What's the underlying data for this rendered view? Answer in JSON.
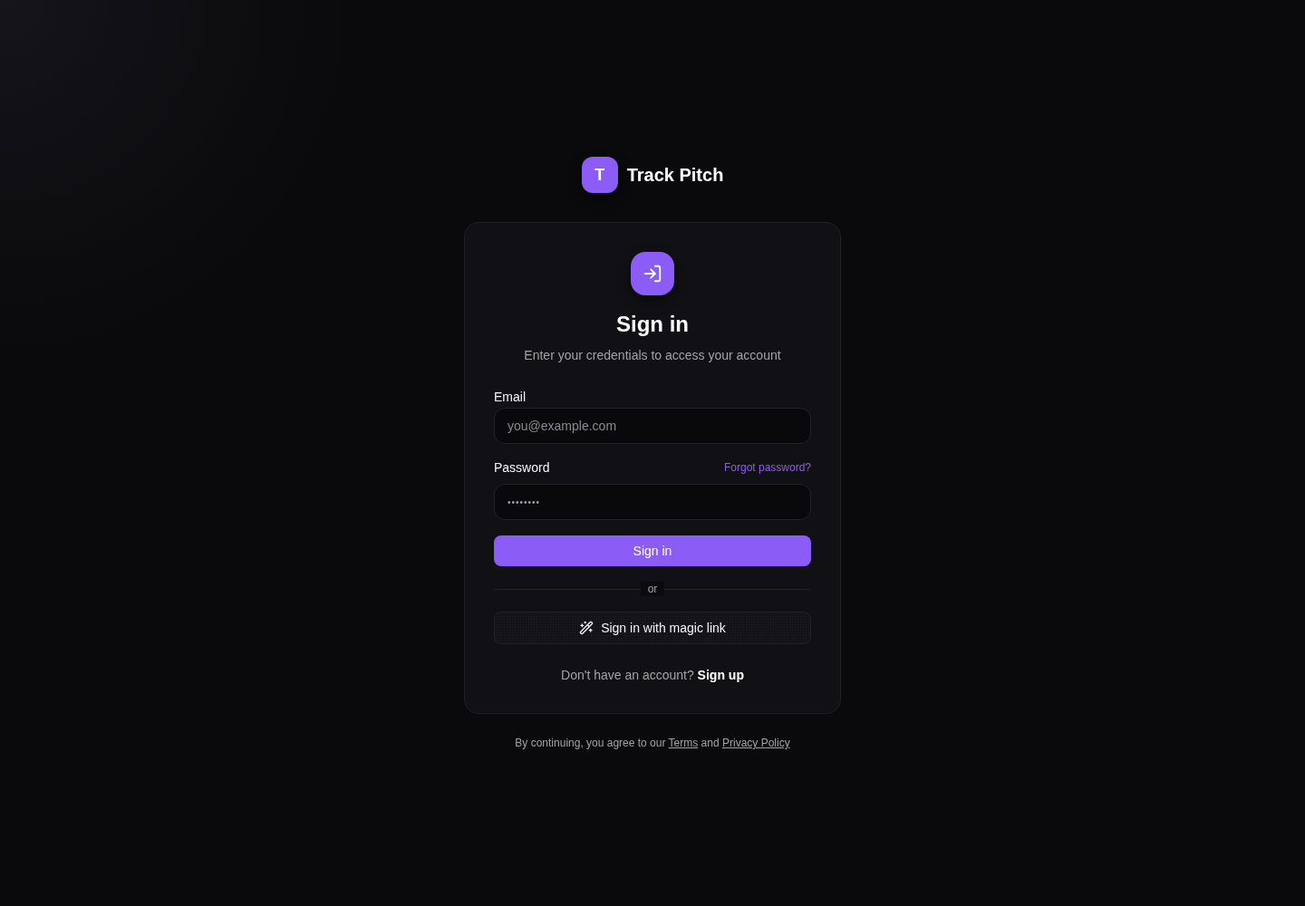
{
  "brand": {
    "logo_letter": "T",
    "name": "Track Pitch"
  },
  "card": {
    "title": "Sign in",
    "subtitle": "Enter your credentials to access your account",
    "fields": [
      {
        "kind": "email",
        "label": "Email",
        "placeholder": "you@example.com"
      },
      {
        "kind": "password",
        "label": "Password",
        "value": "••••••••",
        "link": "Forgot password?"
      }
    ],
    "submit_button": "Sign in",
    "divider": "or",
    "magic_link_button": "Sign in with magic link",
    "signup_prompt": {
      "text": "Don't have an account?",
      "link": "Sign up"
    }
  },
  "footer": {
    "text_before": "By continuing, you agree to our",
    "terms_link": "Terms",
    "middle": "and",
    "privacy_link": "Privacy Policy"
  }
}
